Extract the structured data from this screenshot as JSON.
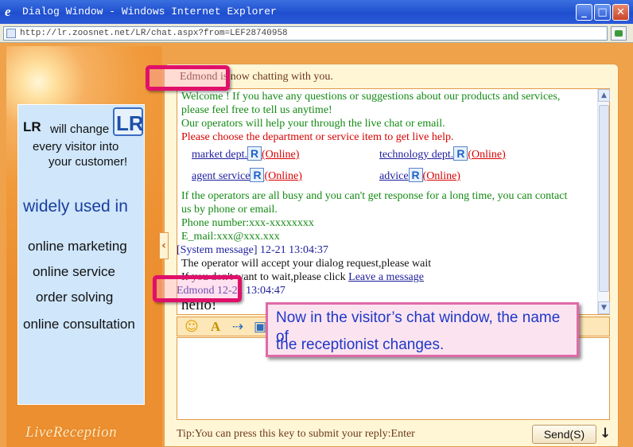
{
  "window": {
    "title": "Dialog Window - Windows Internet Explorer",
    "url": "http://lr.zoosnet.net/LR/chat.aspx?from=LEF28740958",
    "min_glyph": "_",
    "max_glyph": "□",
    "close_glyph": "✕"
  },
  "promo": {
    "lr": "LR",
    "line1": "will change",
    "line2": "every visitor into",
    "line3": "your customer!",
    "widely": "widely used in",
    "features": [
      "online marketing",
      "online service",
      "order solving",
      "online consultation"
    ],
    "brand": "LiveReception"
  },
  "chat": {
    "status": "Edmond is now chatting with you.",
    "welcome1": "Welcome ! If you have any questions or suggestions about our products and services,",
    "welcome2": "please feel free to tell us anytime!",
    "welcome3": "Our operators will help your through the live chat or email.",
    "choose": "Please choose the department or service item to get live help.",
    "departments": [
      {
        "name": "market dept.",
        "status": "(Online)"
      },
      {
        "name": "technology dept.",
        "status": "(Online)"
      },
      {
        "name": "agent service",
        "status": "(Online)"
      },
      {
        "name": "advice",
        "status": "(Online)"
      }
    ],
    "busy1": "If the operators are all busy and you can't get response for a long time, you can contact",
    "busy2": "us by phone or email.",
    "phone": "Phone number:xxx-xxxxxxxx",
    "email": "E_mail:xxx@xxx.xxx",
    "sys_header": "[System message] 12-21 13:04:37",
    "sys1": "The operator will accept your dialog request,please wait",
    "sys2_prefix": "If you don't want to wait,please click ",
    "sys2_link": "Leave a message",
    "agent_header": "Edmond 12-21 13:04:47",
    "agent_msg": "hello!",
    "tip": "Tip:You can press this key to submit your reply:Enter",
    "send": "Send(S)",
    "collapse_glyph": "‹",
    "down_glyph": "↓",
    "scroll_up_glyph": "▲",
    "scroll_down_glyph": "▼"
  },
  "toolbar": {
    "emoji_glyph": "☺",
    "font_glyph": "A",
    "file_glyph": "⇢",
    "screen_glyph": "▣"
  },
  "annotation": {
    "line1": "Now in the visitor’s chat window, the name of",
    "line2": "the receptionist changes."
  },
  "colors": {
    "accent_orange": "#f0a24a",
    "highlight_pink": "#e0106a",
    "welcome_green": "#148a14",
    "alert_red": "#d80000",
    "link_blue": "#1d1d9e"
  }
}
